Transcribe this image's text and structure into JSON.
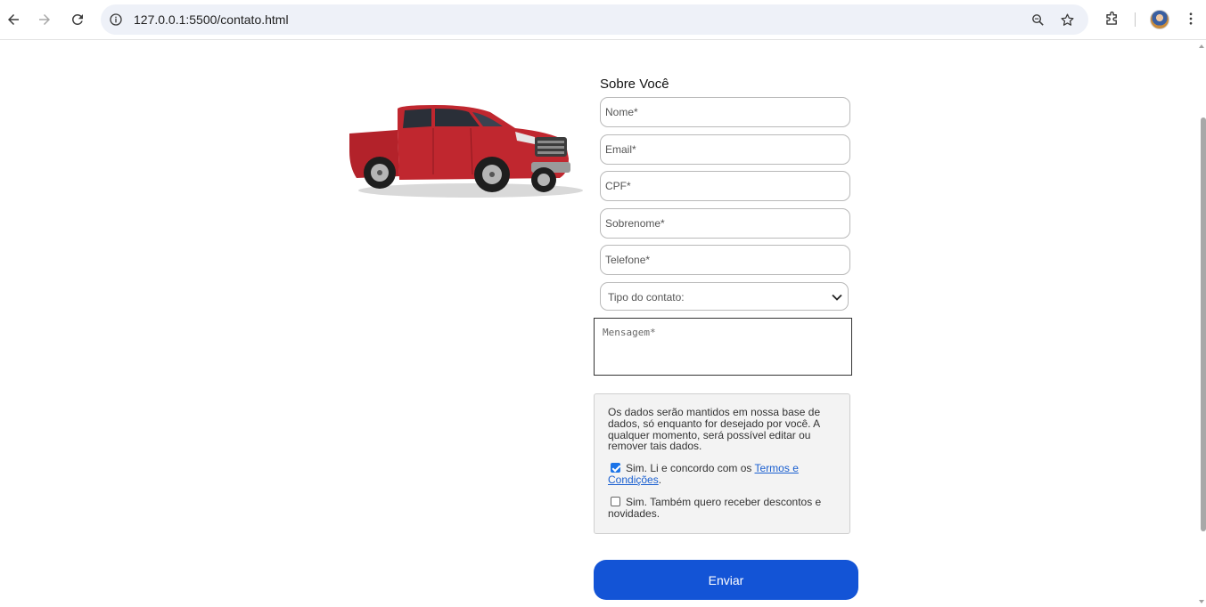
{
  "browser": {
    "url_host": "127.0.0.1:5500",
    "url_path": "/contato.html",
    "icons": [
      "back-arrow-icon",
      "forward-arrow-icon",
      "reload-icon",
      "site-info-icon",
      "zoom-icon",
      "bookmark-star-icon",
      "extensions-icon",
      "profile-avatar",
      "more-menu-icon"
    ]
  },
  "hero": {
    "image": "red-pickup-truck"
  },
  "form": {
    "title": "Sobre Você",
    "fields": {
      "nome": "Nome*",
      "email": "Email*",
      "cpf": "CPF*",
      "sobrenome": "Sobrenome*",
      "telefone": "Telefone*"
    },
    "select": {
      "value": "Tipo do contato:"
    },
    "message_placeholder": "Mensagem*",
    "consent": {
      "privacy_text": "Os dados serão mantidos em nossa base de dados, só enquanto for desejado por você. A qualquer momento, será possível editar ou remover tais dados.",
      "terms": {
        "checked": true,
        "text": "Sim. Li e concordo com os ",
        "link": "Termos e Condições",
        "suffix": "."
      },
      "newsletter": {
        "checked": false,
        "text": "Sim. Também quero receber descontos e novidades."
      }
    },
    "submit_label": "Enviar"
  },
  "colors": {
    "primary_button": "#1354d6",
    "link": "#1a5fd0",
    "checkbox_checked": "#1a73e8",
    "consent_bg": "#f3f3f3",
    "truck_body": "#b3222a"
  }
}
